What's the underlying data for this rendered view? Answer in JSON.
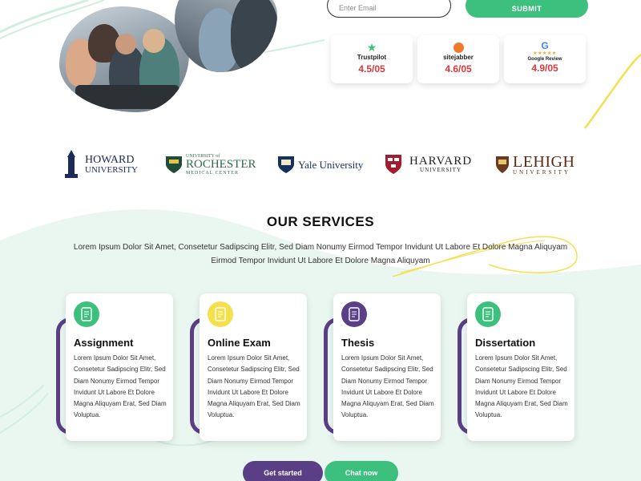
{
  "colors": {
    "green": "#3dbf7e",
    "purple": "#5b3f86",
    "yellow": "#f4e04d",
    "rating_red": "#d9393c",
    "navy": "#1e2b5a",
    "mint_bg": "#eaf7f1"
  },
  "form": {
    "email_placeholder": "Enter Email",
    "submit_label": "SUBMIT"
  },
  "ratings": [
    {
      "brand": "Trustpilot",
      "icon": "trustpilot-star-icon",
      "score": "4.5/05"
    },
    {
      "brand": "sitejabber",
      "icon": "sitejabber-icon",
      "score": "4.6/05"
    },
    {
      "brand": "Google Review",
      "icon": "google-g-icon",
      "score": "4.9/05"
    }
  ],
  "universities": {
    "howard": {
      "line1": "HOWARD",
      "line2": "UNIVERSITY"
    },
    "rochester": {
      "line1": "UNIVERSITY of",
      "line2": "ROCHESTER",
      "line3": "MEDICAL CENTER"
    },
    "yale": {
      "name": "Yale University"
    },
    "harvard": {
      "line1": "HARVARD",
      "line2": "UNIVERSITY"
    },
    "lehigh": {
      "line1": "LEHIGH",
      "line2": "UNIVERSITY"
    }
  },
  "services": {
    "title": "OUR SERVICES",
    "description": "Lorem Ipsum Dolor Sit Amet, Consetetur Sadipscing Elitr, Sed Diam Nonumy Eirmod Tempor Invidunt Ut Labore Et Dolore Magna Aliquyam Eirmod Tempor Invidunt Ut Labore Et Dolore Magna Aliquyam",
    "cards": [
      {
        "title": "Assignment",
        "icon": "document-icon",
        "body": "Lorem Ipsum Dolor Sit Amet, Consetetur Sadipscing Elitr, Sed Diam Nonumy Eirmod Tempor Invidunt Ut Labore Et Dolore Magna Aliquyam Erat, Sed Diam Voluptua."
      },
      {
        "title": "Online Exam",
        "icon": "document-icon",
        "body": "Lorem Ipsum Dolor Sit Amet, Consetetur Sadipscing Elitr, Sed Diam Nonumy Eirmod Tempor Invidunt Ut Labore Et Dolore Magna Aliquyam Erat, Sed Diam Voluptua."
      },
      {
        "title": "Thesis",
        "icon": "document-icon",
        "body": "Lorem Ipsum Dolor Sit Amet, Consetetur Sadipscing Elitr, Sed Diam Nonumy Eirmod Tempor Invidunt Ut Labore Et Dolore Magna Aliquyam Erat, Sed Diam Voluptua."
      },
      {
        "title": "Dissertation",
        "icon": "document-icon",
        "body": "Lorem Ipsum Dolor Sit Amet, Consetetur Sadipscing Elitr, Sed Diam Nonumy Eirmod Tempor Invidunt Ut Labore Et Dolore Magna Aliquyam Erat, Sed Diam Voluptua."
      }
    ]
  },
  "cta": {
    "get_started": "Get started",
    "chat_now": "Chat now"
  }
}
